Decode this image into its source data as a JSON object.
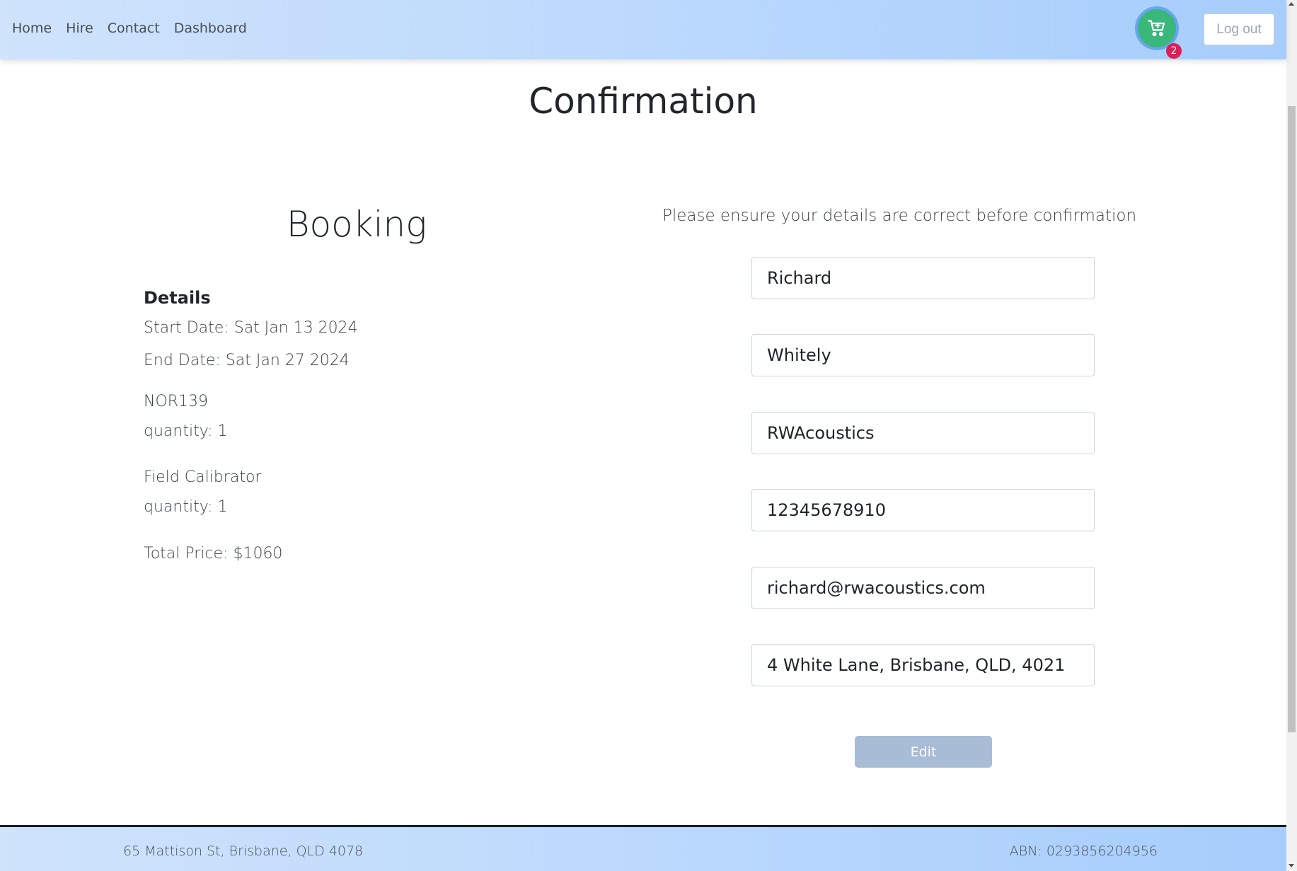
{
  "nav": {
    "links": [
      "Home",
      "Hire",
      "Contact",
      "Dashboard"
    ],
    "cart_icon": "shopping-cart-icon",
    "cart_count": "2",
    "logout_label": "Log out"
  },
  "page": {
    "title": "Confirmation"
  },
  "booking": {
    "heading": "Booking",
    "details_label": "Details",
    "start_date": "Start Date: Sat Jan 13 2024",
    "end_date": "End Date: Sat Jan 27 2024",
    "items": [
      {
        "name": "NOR139",
        "quantity": "quantity: 1"
      },
      {
        "name": "Field Calibrator",
        "quantity": "quantity: 1"
      }
    ],
    "total": "Total Price: $1060"
  },
  "form": {
    "notice": "Please ensure your details are correct before confirmation",
    "fields": {
      "first_name": "Richard",
      "last_name": "Whitely",
      "company": "RWAcoustics",
      "phone": "12345678910",
      "email": "richard@rwacoustics.com",
      "address": "4 White Lane, Brisbane, QLD, 4021"
    },
    "edit_label": "Edit"
  },
  "footer": {
    "address": "65 Mattison St, Brisbane, QLD 4078",
    "abn": "ABN: 0293856204956"
  },
  "colors": {
    "nav_gradient": [
      "#cfe3fb",
      "#a6cdfc"
    ],
    "cart_button": "#3ab77a",
    "cart_badge": "#dc1f55",
    "edit_button": "#a8bcd6"
  }
}
